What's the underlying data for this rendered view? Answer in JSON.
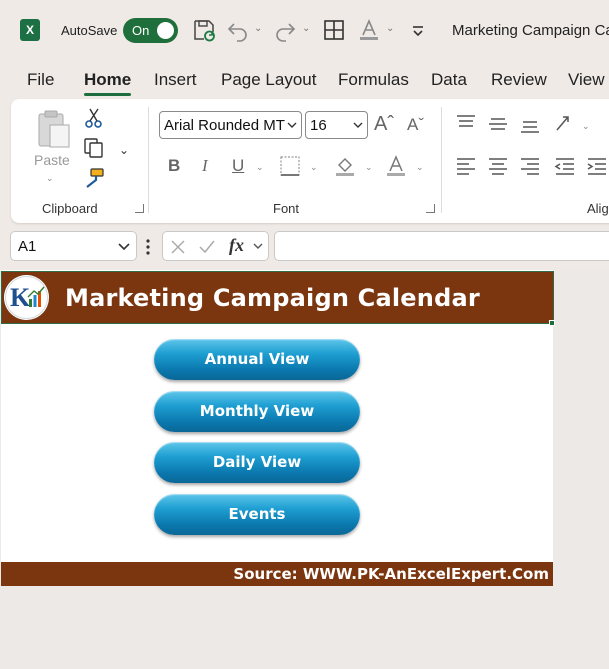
{
  "titlebar": {
    "app_logo": "X",
    "autosave_label": "AutoSave",
    "autosave_state": "On",
    "document_title": "Marketing Campaign Ca",
    "icons": [
      "save-sync-icon",
      "undo-icon",
      "redo-icon",
      "borders-icon",
      "font-color-icon",
      "customize-qat-icon"
    ]
  },
  "ribbon_tabs": [
    "File",
    "Home",
    "Insert",
    "Page Layout",
    "Formulas",
    "Data",
    "Review",
    "View"
  ],
  "active_tab": "Home",
  "ribbon": {
    "clipboard": {
      "paste_label": "Paste",
      "group_label": "Clipboard",
      "icons": [
        "paste-icon",
        "cut-icon",
        "copy-icon",
        "format-painter-icon"
      ]
    },
    "font": {
      "font_name": "Arial Rounded MT",
      "font_size": "16",
      "group_label": "Font",
      "bold": "B",
      "italic": "I",
      "underline": "U",
      "icons": [
        "increase-font-icon",
        "decrease-font-icon",
        "borders-icon",
        "fill-color-icon",
        "font-color-icon"
      ]
    },
    "alignment": {
      "group_label": "Alig",
      "icons": [
        "top-align-icon",
        "middle-align-icon",
        "bottom-align-icon",
        "orientation-icon",
        "align-left-icon",
        "center-icon",
        "align-right-icon",
        "decrease-indent-icon",
        "increase-indent-icon"
      ]
    }
  },
  "formula_bar": {
    "name_box": "A1",
    "fx_label": "fx",
    "formula": ""
  },
  "sheet": {
    "banner_title": "Marketing Campaign Calendar",
    "logo_text": "K",
    "buttons": [
      "Annual View",
      "Monthly View",
      "Daily View",
      "Events"
    ],
    "source": "Source: WWW.PK-AnExcelExpert.Com"
  },
  "colors": {
    "banner": "#7b3610",
    "button": "#1f9fd2",
    "excel_green": "#1d6d3e"
  }
}
